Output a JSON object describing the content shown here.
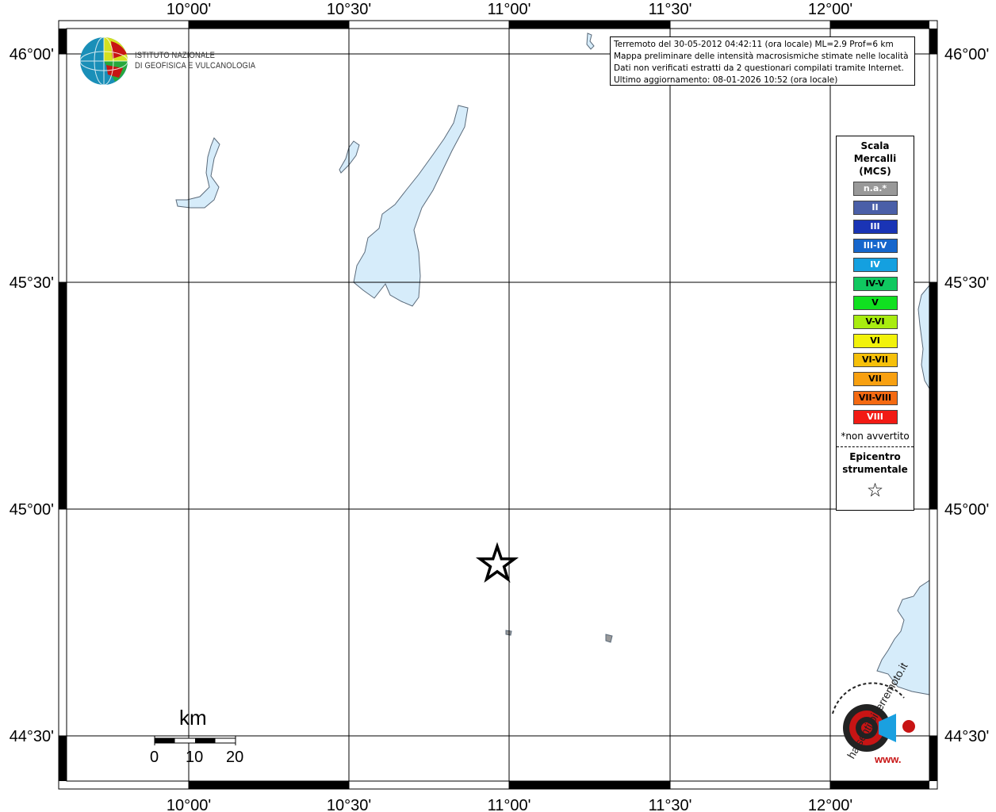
{
  "map": {
    "lon_ticks": [
      "10°00'",
      "10°30'",
      "11°00'",
      "11°30'",
      "12°00'"
    ],
    "lat_ticks": [
      "46°00'",
      "45°30'",
      "45°00'",
      "44°30'"
    ],
    "epicenter_symbol": "star"
  },
  "info": {
    "line1": "Terremoto del 30-05-2012 04:42:11 (ora locale) ML=2.9 Prof=6 km",
    "line2": "Mappa preliminare delle intensità macrosismiche stimate nelle località",
    "line3": "Dati non verificati estratti da 2 questionari compilati tramite Internet.",
    "line4": "Ultimo aggiornamento: 08-01-2026 10:52 (ora locale)"
  },
  "logo": {
    "line1": "ISTITUTO NAZIONALE",
    "line2": "DI GEOFISICA E VULCANOLOGIA"
  },
  "legend": {
    "title_line1": "Scala",
    "title_line2": "Mercalli",
    "title_line3": "(MCS)",
    "items": [
      {
        "label": "n.a.*",
        "color": "#999999"
      },
      {
        "label": "II",
        "color": "#4a5fa8"
      },
      {
        "label": "III",
        "color": "#1a34b5"
      },
      {
        "label": "III-IV",
        "color": "#1666cc"
      },
      {
        "label": "IV",
        "color": "#14a0e0"
      },
      {
        "label": "IV-V",
        "color": "#10c860"
      },
      {
        "label": "V",
        "color": "#10e020"
      },
      {
        "label": "V-VI",
        "color": "#a8ec10"
      },
      {
        "label": "VI",
        "color": "#f2f20a"
      },
      {
        "label": "VI-VII",
        "color": "#f6c00a"
      },
      {
        "label": "VII",
        "color": "#f8a010"
      },
      {
        "label": "VII-VIII",
        "color": "#f46a12"
      },
      {
        "label": "VIII",
        "color": "#f21a14"
      }
    ],
    "note": "*non avvertito",
    "epicenter_line1": "Epicentro",
    "epicenter_line2": "strumentale",
    "epicenter_symbol": "☆"
  },
  "scale": {
    "unit": "km",
    "labels": [
      "0",
      "10",
      "20"
    ]
  },
  "watermark": {
    "text": "haisentitoilterremoto.it",
    "url": "www."
  }
}
